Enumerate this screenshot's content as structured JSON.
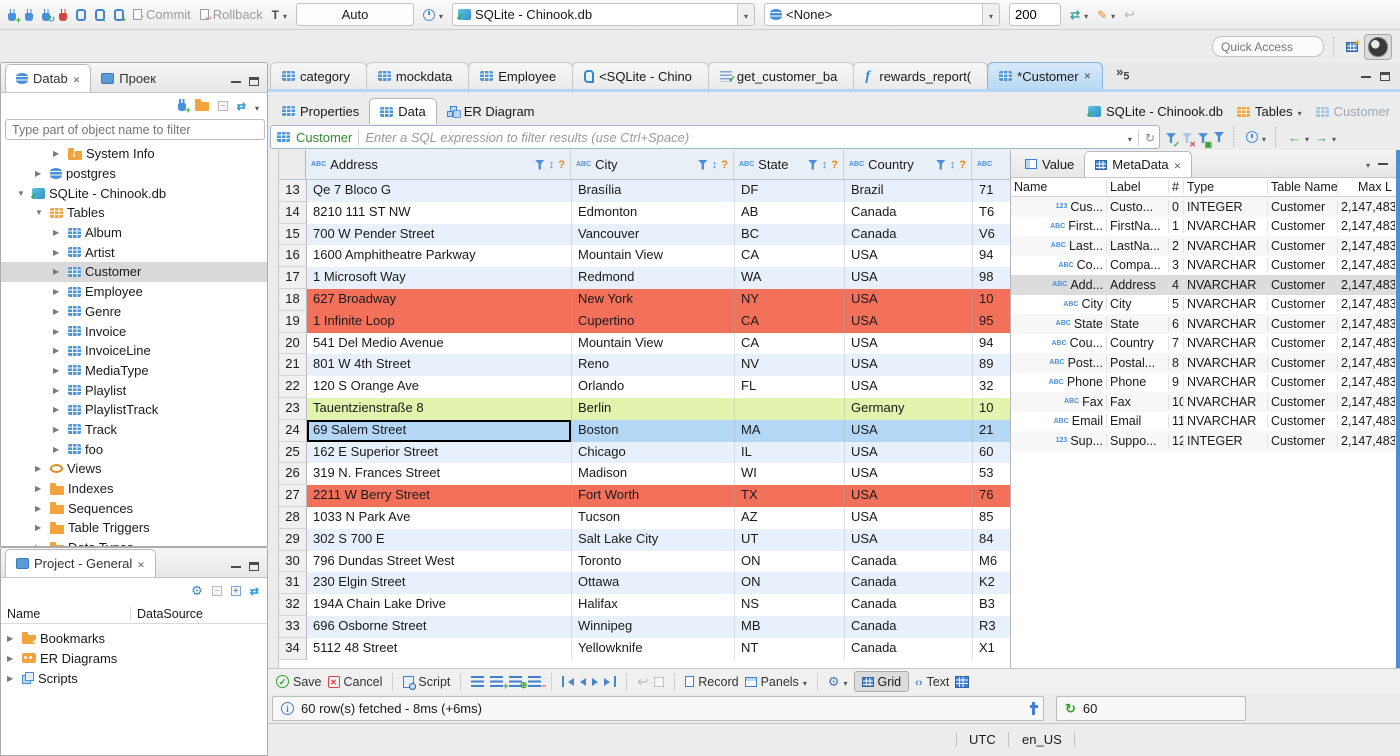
{
  "colors": {
    "accent_blue": "#4a90d9",
    "row_red": "#f3705a",
    "row_green": "#e2f4ad",
    "row_selected": "#b5d7f6",
    "row_alt": "#e8f1fb",
    "active_tab_blue": "#b9d9f3"
  },
  "toolbar": {
    "commit_label": "Commit",
    "rollback_label": "Rollback",
    "txn_mode": "Auto",
    "connection": "SQLite - Chinook.db",
    "database": "<None>",
    "fetch_size": "200"
  },
  "quick_access_placeholder": "Quick Access",
  "db_navigator": {
    "tab_database": "Datab",
    "tab_project": "Проек",
    "filter_placeholder": "Type part of object name to filter",
    "tree": [
      {
        "arrow": "▶",
        "icon": "folder-info-icon",
        "label": "System Info",
        "indent": 3
      },
      {
        "arrow": "▶",
        "icon": "db-icon",
        "label": "postgres",
        "indent": 2
      },
      {
        "arrow": "▼",
        "icon": "db-check-icon",
        "label": "SQLite - Chinook.db",
        "indent": 1
      },
      {
        "arrow": "▼",
        "icon": "folder-table-icon",
        "label": "Tables",
        "indent": 2
      },
      {
        "arrow": "▶",
        "icon": "table-icon",
        "label": "Album",
        "indent": 3
      },
      {
        "arrow": "▶",
        "icon": "table-icon",
        "label": "Artist",
        "indent": 3
      },
      {
        "arrow": "▶",
        "icon": "table-icon",
        "label": "Customer",
        "indent": 3,
        "cls": "selected"
      },
      {
        "arrow": "▶",
        "icon": "table-icon",
        "label": "Employee",
        "indent": 3
      },
      {
        "arrow": "▶",
        "icon": "table-icon",
        "label": "Genre",
        "indent": 3
      },
      {
        "arrow": "▶",
        "icon": "table-icon",
        "label": "Invoice",
        "indent": 3
      },
      {
        "arrow": "▶",
        "icon": "table-icon",
        "label": "InvoiceLine",
        "indent": 3
      },
      {
        "arrow": "▶",
        "icon": "table-icon",
        "label": "MediaType",
        "indent": 3
      },
      {
        "arrow": "▶",
        "icon": "table-icon",
        "label": "Playlist",
        "indent": 3
      },
      {
        "arrow": "▶",
        "icon": "table-icon",
        "label": "PlaylistTrack",
        "indent": 3
      },
      {
        "arrow": "▶",
        "icon": "table-icon",
        "label": "Track",
        "indent": 3
      },
      {
        "arrow": "▶",
        "icon": "table-icon",
        "label": "foo",
        "indent": 3
      },
      {
        "arrow": "▶",
        "icon": "views-icon",
        "label": "Views",
        "indent": 2
      },
      {
        "arrow": "▶",
        "icon": "folder-icon",
        "label": "Indexes",
        "indent": 2
      },
      {
        "arrow": "▶",
        "icon": "folder-icon",
        "label": "Sequences",
        "indent": 2
      },
      {
        "arrow": "▶",
        "icon": "folder-icon",
        "label": "Table Triggers",
        "indent": 2
      },
      {
        "arrow": "▶",
        "icon": "folder-icon",
        "label": "Data Types",
        "indent": 2
      }
    ]
  },
  "project_panel": {
    "title": "Project - General",
    "col_name": "Name",
    "col_datasource": "DataSource",
    "tree": [
      {
        "arrow": "▶",
        "icon": "folder-star-icon",
        "label": "Bookmarks"
      },
      {
        "arrow": "▶",
        "icon": "er-diagram-icon",
        "label": "ER Diagrams"
      },
      {
        "arrow": "▶",
        "icon": "scripts-icon",
        "label": "Scripts"
      }
    ]
  },
  "editor_tabs": [
    {
      "icon": "table-icon",
      "label": "category"
    },
    {
      "icon": "table-icon",
      "label": "mockdata"
    },
    {
      "icon": "table-icon",
      "label": "Employee"
    },
    {
      "icon": "sql-script-icon",
      "label": "<SQLite - Chino"
    },
    {
      "icon": "script-check-icon",
      "label": "get_customer_ba"
    },
    {
      "icon": "function-icon",
      "label": "rewards_report("
    },
    {
      "icon": "table-icon",
      "label": "*Customer",
      "cls": "active",
      "close": "✕"
    }
  ],
  "more_editors_count": "5",
  "result_tabs": {
    "properties": "Properties",
    "data": "Data",
    "er_diagram": "ER Diagram"
  },
  "breadcrumb": {
    "connection": "SQLite - Chinook.db",
    "container": "Tables",
    "entity": "Customer"
  },
  "filter_bar": {
    "entity": "Customer",
    "placeholder": "Enter a SQL expression to filter results (use Ctrl+Space)"
  },
  "grid": {
    "abc_label": "ABC",
    "columns": [
      "Address",
      "City",
      "State",
      "Country"
    ],
    "rows": [
      {
        "num": "13",
        "address": "Qe 7 Bloco G",
        "city": "Brasília",
        "state": "DF",
        "country": "Brazil",
        "extra": "71",
        "cls": "alt"
      },
      {
        "num": "14",
        "address": "8210 111 ST NW",
        "city": "Edmonton",
        "state": "AB",
        "country": "Canada",
        "extra": "T6"
      },
      {
        "num": "15",
        "address": "700 W Pender Street",
        "city": "Vancouver",
        "state": "BC",
        "country": "Canada",
        "extra": "V6",
        "cls": "alt"
      },
      {
        "num": "16",
        "address": "1600 Amphitheatre Parkway",
        "city": "Mountain View",
        "state": "CA",
        "country": "USA",
        "extra": "94"
      },
      {
        "num": "17",
        "address": "1 Microsoft Way",
        "city": "Redmond",
        "state": "WA",
        "country": "USA",
        "extra": "98",
        "cls": "alt"
      },
      {
        "num": "18",
        "address": "627 Broadway",
        "city": "New York",
        "state": "NY",
        "country": "USA",
        "extra": "10",
        "cls": "red"
      },
      {
        "num": "19",
        "address": "1 Infinite Loop",
        "city": "Cupertino",
        "state": "CA",
        "country": "USA",
        "extra": "95",
        "cls": "red"
      },
      {
        "num": "20",
        "address": "541 Del Medio Avenue",
        "city": "Mountain View",
        "state": "CA",
        "country": "USA",
        "extra": "94"
      },
      {
        "num": "21",
        "address": "801 W 4th Street",
        "city": "Reno",
        "state": "NV",
        "country": "USA",
        "extra": "89",
        "cls": "alt"
      },
      {
        "num": "22",
        "address": "120 S Orange Ave",
        "city": "Orlando",
        "state": "FL",
        "country": "USA",
        "extra": "32"
      },
      {
        "num": "23",
        "address": "Tauentzienstraße 8",
        "city": "Berlin",
        "state": "",
        "country": "Germany",
        "extra": "10",
        "cls": "green"
      },
      {
        "num": "24",
        "address": "69 Salem Street",
        "city": "Boston",
        "state": "MA",
        "country": "USA",
        "extra": "21",
        "cls": "sel"
      },
      {
        "num": "25",
        "address": "162 E Superior Street",
        "city": "Chicago",
        "state": "IL",
        "country": "USA",
        "extra": "60",
        "cls": "alt"
      },
      {
        "num": "26",
        "address": "319 N. Frances Street",
        "city": "Madison",
        "state": "WI",
        "country": "USA",
        "extra": "53"
      },
      {
        "num": "27",
        "address": "2211 W Berry Street",
        "city": "Fort Worth",
        "state": "TX",
        "country": "USA",
        "extra": "76",
        "cls": "red"
      },
      {
        "num": "28",
        "address": "1033 N Park Ave",
        "city": "Tucson",
        "state": "AZ",
        "country": "USA",
        "extra": "85"
      },
      {
        "num": "29",
        "address": "302 S 700 E",
        "city": "Salt Lake City",
        "state": "UT",
        "country": "USA",
        "extra": "84",
        "cls": "alt"
      },
      {
        "num": "30",
        "address": "796 Dundas Street West",
        "city": "Toronto",
        "state": "ON",
        "country": "Canada",
        "extra": "M6"
      },
      {
        "num": "31",
        "address": "230 Elgin Street",
        "city": "Ottawa",
        "state": "ON",
        "country": "Canada",
        "extra": "K2",
        "cls": "alt"
      },
      {
        "num": "32",
        "address": "194A Chain Lake Drive",
        "city": "Halifax",
        "state": "NS",
        "country": "Canada",
        "extra": "B3"
      },
      {
        "num": "33",
        "address": "696 Osborne Street",
        "city": "Winnipeg",
        "state": "MB",
        "country": "Canada",
        "extra": "R3",
        "cls": "alt"
      },
      {
        "num": "34",
        "address": "5112 48 Street",
        "city": "Yellowknife",
        "state": "NT",
        "country": "Canada",
        "extra": "X1"
      }
    ]
  },
  "metadata_panel": {
    "tab_value": "Value",
    "tab_metadata": "MetaData",
    "columns": [
      "Name",
      "Label",
      "#",
      "Type",
      "Table Name",
      "Max L"
    ],
    "rows": [
      {
        "kind": "123",
        "name": "Cus...",
        "label": "Custo...",
        "idx": "0",
        "type": "INTEGER",
        "table": "Customer",
        "max": "2,147,483"
      },
      {
        "kind": "ABC",
        "name": "First...",
        "label": "FirstNa...",
        "idx": "1",
        "type": "NVARCHAR",
        "table": "Customer",
        "max": "2,147,483"
      },
      {
        "kind": "ABC",
        "name": "Last...",
        "label": "LastNa...",
        "idx": "2",
        "type": "NVARCHAR",
        "table": "Customer",
        "max": "2,147,483"
      },
      {
        "kind": "ABC",
        "name": "Co...",
        "label": "Compa...",
        "idx": "3",
        "type": "NVARCHAR",
        "table": "Customer",
        "max": "2,147,483"
      },
      {
        "kind": "ABC",
        "name": "Add...",
        "label": "Address",
        "idx": "4",
        "type": "NVARCHAR",
        "table": "Customer",
        "max": "2,147,483",
        "cls": "selected"
      },
      {
        "kind": "ABC",
        "name": "City",
        "label": "City",
        "idx": "5",
        "type": "NVARCHAR",
        "table": "Customer",
        "max": "2,147,483"
      },
      {
        "kind": "ABC",
        "name": "State",
        "label": "State",
        "idx": "6",
        "type": "NVARCHAR",
        "table": "Customer",
        "max": "2,147,483"
      },
      {
        "kind": "ABC",
        "name": "Cou...",
        "label": "Country",
        "idx": "7",
        "type": "NVARCHAR",
        "table": "Customer",
        "max": "2,147,483"
      },
      {
        "kind": "ABC",
        "name": "Post...",
        "label": "Postal...",
        "idx": "8",
        "type": "NVARCHAR",
        "table": "Customer",
        "max": "2,147,483"
      },
      {
        "kind": "ABC",
        "name": "Phone",
        "label": "Phone",
        "idx": "9",
        "type": "NVARCHAR",
        "table": "Customer",
        "max": "2,147,483"
      },
      {
        "kind": "ABC",
        "name": "Fax",
        "label": "Fax",
        "idx": "10",
        "type": "NVARCHAR",
        "table": "Customer",
        "max": "2,147,483"
      },
      {
        "kind": "ABC",
        "name": "Email",
        "label": "Email",
        "idx": "11",
        "type": "NVARCHAR",
        "table": "Customer",
        "max": "2,147,483"
      },
      {
        "kind": "123",
        "name": "Sup...",
        "label": "Suppo...",
        "idx": "12",
        "type": "INTEGER",
        "table": "Customer",
        "max": "2,147,483"
      }
    ]
  },
  "bottom_toolbar": {
    "save": "Save",
    "cancel": "Cancel",
    "script": "Script",
    "record": "Record",
    "panels": "Panels",
    "grid": "Grid",
    "text": "Text"
  },
  "status": {
    "fetch_message": "60 row(s) fetched - 8ms (+6ms)",
    "refresh_count": "60"
  },
  "window_statusbar": {
    "timezone": "UTC",
    "locale": "en_US"
  }
}
